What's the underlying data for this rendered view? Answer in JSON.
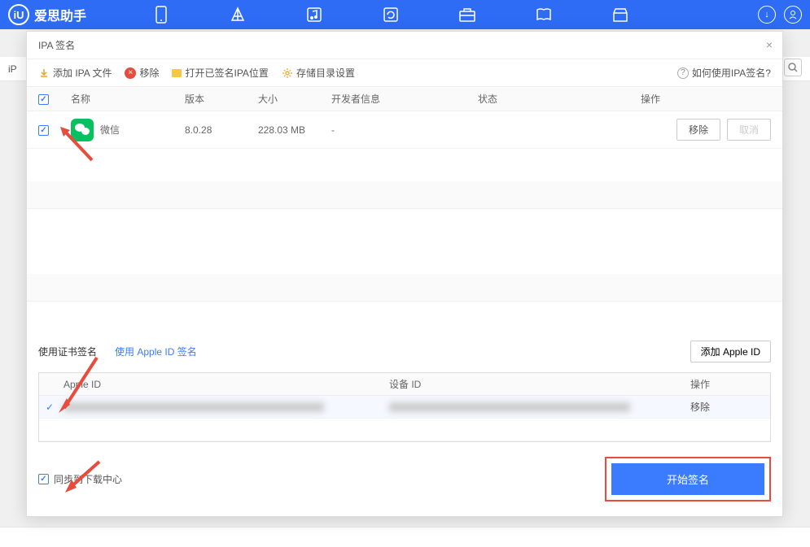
{
  "app_name": "爱思助手",
  "logo_letter": "iU",
  "dialog": {
    "title": "IPA 签名",
    "toolbar": {
      "add_ipa": "添加 IPA 文件",
      "remove": "移除",
      "open_signed": "打开已签名IPA位置",
      "storage_settings": "存储目录设置",
      "help": "如何使用IPA签名?"
    },
    "table": {
      "headers": {
        "name": "名称",
        "version": "版本",
        "size": "大小",
        "developer": "开发者信息",
        "status": "状态",
        "operation": "操作"
      },
      "rows": [
        {
          "name": "微信",
          "version": "8.0.28",
          "size": "228.03 MB",
          "developer": "-",
          "remove_btn": "移除",
          "cancel_btn": "取消"
        }
      ]
    },
    "sign_tabs": {
      "cert": "使用证书签名",
      "appleid": "使用 Apple ID 签名",
      "add_appleid_btn": "添加 Apple ID"
    },
    "id_table": {
      "headers": {
        "apple_id": "Apple ID",
        "device_id": "设备 ID",
        "operation": "操作"
      },
      "rows": [
        {
          "remove": "移除"
        }
      ]
    },
    "footer": {
      "sync_label": "同步到下载中心",
      "start_btn": "开始签名"
    }
  },
  "bg_label": "iP"
}
